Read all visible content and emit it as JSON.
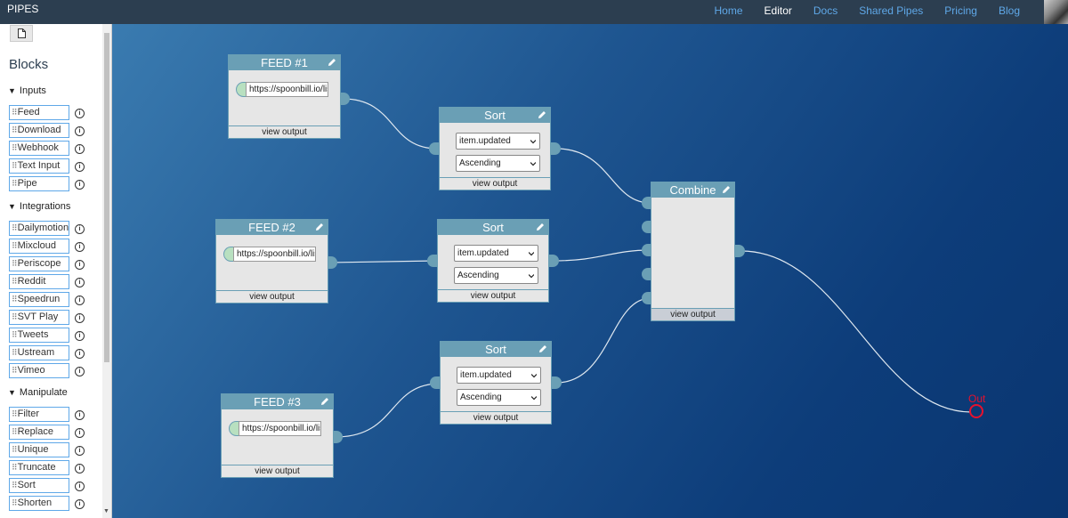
{
  "app": {
    "brand": "PIPES"
  },
  "nav": {
    "links": [
      "Home",
      "Editor",
      "Docs",
      "Shared Pipes",
      "Pricing",
      "Blog"
    ],
    "active": "Editor"
  },
  "sidebar": {
    "title": "Blocks",
    "new_icon": "file-icon",
    "groups": [
      {
        "title": "Inputs",
        "items": [
          "Feed",
          "Download",
          "Webhook",
          "Text Input",
          "Pipe"
        ]
      },
      {
        "title": "Integrations",
        "items": [
          "Dailymotion",
          "Mixcloud",
          "Periscope",
          "Reddit",
          "Speedrun",
          "SVT Play",
          "Tweets",
          "Ustream",
          "Vimeo"
        ]
      },
      {
        "title": "Manipulate",
        "items": [
          "Filter",
          "Replace",
          "Unique",
          "Truncate",
          "Sort",
          "Shorten"
        ]
      }
    ]
  },
  "nodes": {
    "feed1": {
      "title": "FEED #1",
      "url": "https://spoonbill.io/lis",
      "footer": "view output"
    },
    "feed2": {
      "title": "FEED #2",
      "url": "https://spoonbill.io/lis",
      "footer": "view output"
    },
    "feed3": {
      "title": "FEED #3",
      "url": "https://spoonbill.io/lis",
      "footer": "view output"
    },
    "sort1": {
      "title": "Sort",
      "field": "item.updated",
      "order": "Ascending",
      "footer": "view output"
    },
    "sort2": {
      "title": "Sort",
      "field": "item.updated",
      "order": "Ascending",
      "footer": "view output"
    },
    "sort3": {
      "title": "Sort",
      "field": "item.updated",
      "order": "Ascending",
      "footer": "view output"
    },
    "combine": {
      "title": "Combine",
      "footer": "view output"
    }
  },
  "output": {
    "label": "Out"
  },
  "colors": {
    "navbar": "#2c3e50",
    "node_header": "#6a9fb5",
    "accent_link": "#5fa8e8",
    "out": "#e8112d"
  }
}
